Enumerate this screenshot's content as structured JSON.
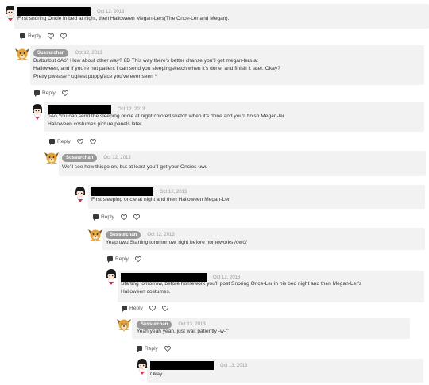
{
  "comments": [
    {
      "author": "",
      "pill": false,
      "date": "Oct 12, 2013",
      "lines": [
        "First snoring Oncie in bed at night, then Halloween Megan-Lers(The Once-Ler and Megan)."
      ],
      "reply": "Reply",
      "avatar": "girl-icon",
      "actions": [
        "reply",
        "heart",
        "heart-outline"
      ]
    },
    {
      "author": "Sussurchan",
      "pill": true,
      "date": "Oct 12, 2013",
      "lines": [
        "Butbutbut óAó'' How about other way? 8D This way there's better chanse you'll get megan-lers at",
        "Halloween, and if you're not patient I can send you sleepingsketch when it's done, and finish it later. Okay?",
        "Pretty pwease * ugliest puppyface you've ever seen *"
      ],
      "reply": "Reply",
      "avatar": "dog-icon",
      "actions": [
        "reply",
        "heart"
      ]
    },
    {
      "author": "",
      "pill": false,
      "date": "Oct 12, 2013",
      "lines": [
        "óAó You can send the sleeping oncie at night colored sketch when it's done and you'll finish Megan-ler",
        "Halloween costumes picture panels later."
      ],
      "reply": "Reply",
      "avatar": "girl-icon",
      "actions": [
        "reply",
        "heart",
        "heart-outline"
      ]
    },
    {
      "author": "Sussurchan",
      "pill": true,
      "date": "Oct 12, 2013",
      "lines": [
        "We'll see how thisgo on, but at least you'll get your Oncies uwu"
      ],
      "reply": "",
      "avatar": "dog-icon",
      "actions": []
    },
    {
      "author": "",
      "pill": false,
      "date": "Oct 12, 2013",
      "lines": [
        "First sleeping oncie at night and then Halloween Megan-Ler"
      ],
      "reply": "Reply",
      "avatar": "girl-icon",
      "actions": [
        "reply",
        "heart",
        "heart-outline"
      ]
    },
    {
      "author": "Sussurchan",
      "pill": true,
      "date": "Oct 12, 2013",
      "lines": [
        "Yeap uwu Starting tommorrow, right before homeworks /ówó/"
      ],
      "reply": "Reply",
      "avatar": "dog-icon",
      "actions": [
        "reply",
        "heart"
      ]
    },
    {
      "author": "",
      "pill": false,
      "date": "Oct 12, 2013",
      "lines": [
        "Starting tomorrow, before homework you'll post Snoring Once-Ler in his bed night and then Megan-Ler's",
        "Halloween costumes."
      ],
      "reply": "Reply",
      "avatar": "girl-icon",
      "actions": [
        "reply",
        "heart",
        "heart-outline"
      ]
    },
    {
      "author": "Sussurchan",
      "pill": true,
      "date": "Oct 13, 2013",
      "lines": [
        "Yeah yeah yeah, just wait patiently -w-'''"
      ],
      "reply": "Reply",
      "avatar": "dog-icon",
      "actions": [
        "reply",
        "heart"
      ]
    },
    {
      "author": "",
      "pill": false,
      "date": "Oct 13, 2013",
      "lines": [
        "Okay"
      ],
      "reply": "",
      "avatar": "girl-icon",
      "actions": []
    }
  ],
  "colors": {
    "bubble": "#f2f2f2",
    "pill": "#9a9a9a",
    "redaction": "#000000",
    "heart-red": "#d9324a"
  }
}
